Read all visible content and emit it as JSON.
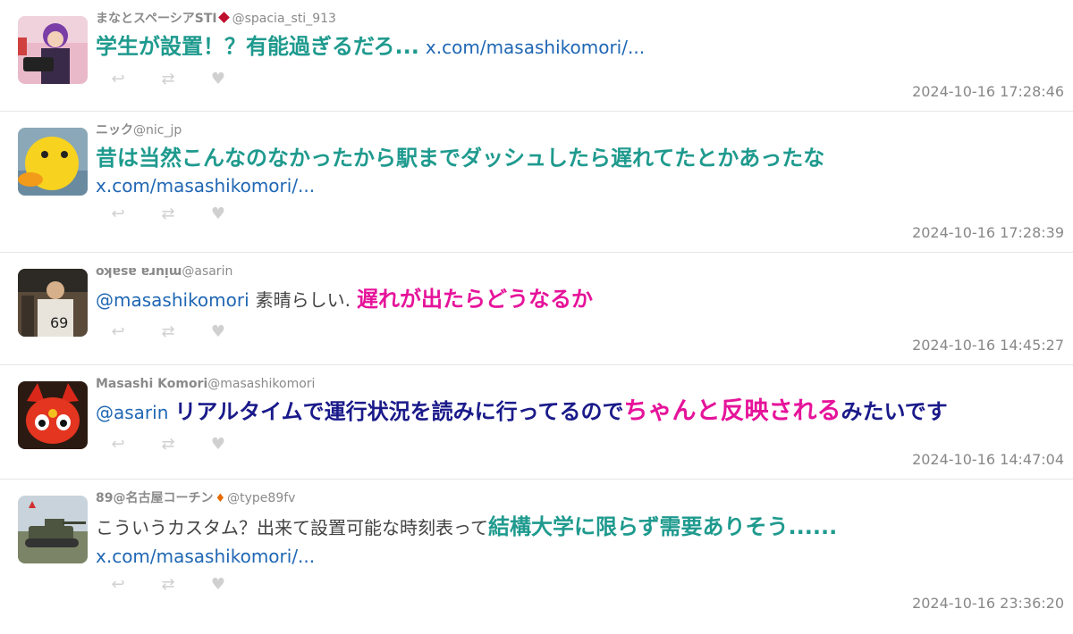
{
  "tweets": [
    {
      "name": "まなとスペーシアSTI",
      "handle": "@spacia_sti_913",
      "avatar_icon": "person-photo-icon",
      "body": {
        "highlight": "学生が設置！？有能過ぎるだろ...",
        "link": "x.com/masashikomori/..."
      },
      "timestamp": "2024-10-16 17:28:46"
    },
    {
      "name": "ニック",
      "handle": "@nic_jp",
      "avatar_icon": "rubber-duck-icon",
      "body": {
        "highlight": "昔は当然こんなのなかったから駅までダッシュしたら遅れてたとかあったな",
        "link": "x.com/masashikomori/..."
      },
      "timestamp": "2024-10-16 17:28:39"
    },
    {
      "name": "miura asako",
      "handle": "@asarin",
      "avatar_icon": "baseball-player-icon",
      "body": {
        "mention": "@masashikomori",
        "plain": "素晴らしい.",
        "highlight": "遅れが出たらどうなるか"
      },
      "timestamp": "2024-10-16 14:45:27"
    },
    {
      "name": "Masashi Komori",
      "handle": "@masashikomori",
      "avatar_icon": "red-mascot-icon",
      "body": {
        "mention": "@asarin",
        "part1": "リアルタイムで運行状況を読みに行ってるので",
        "part2": "ちゃんと反映される",
        "part3": "みたいです"
      },
      "timestamp": "2024-10-16 14:47:04"
    },
    {
      "name": "89@名古屋コーチン",
      "handle": "@type89fv",
      "avatar_icon": "tank-photo-icon",
      "body": {
        "plain": "こういうカスタム？出来て設置可能な時刻表って",
        "highlight": "結構大学に限らず需要ありそう......",
        "link": "x.com/masashikomori/..."
      },
      "timestamp": "2024-10-16 23:36:20"
    }
  ],
  "actions": {
    "reply_icon": "reply-icon",
    "retweet_icon": "retweet-icon",
    "like_icon": "heart-icon"
  },
  "glyphs": {
    "reply": "↩",
    "retweet": "⇄",
    "like": "♥"
  },
  "colors": {
    "teal": "#1f9a8e",
    "magenta": "#e6139a",
    "navy": "#1a1a8a",
    "link": "#2067b4"
  }
}
